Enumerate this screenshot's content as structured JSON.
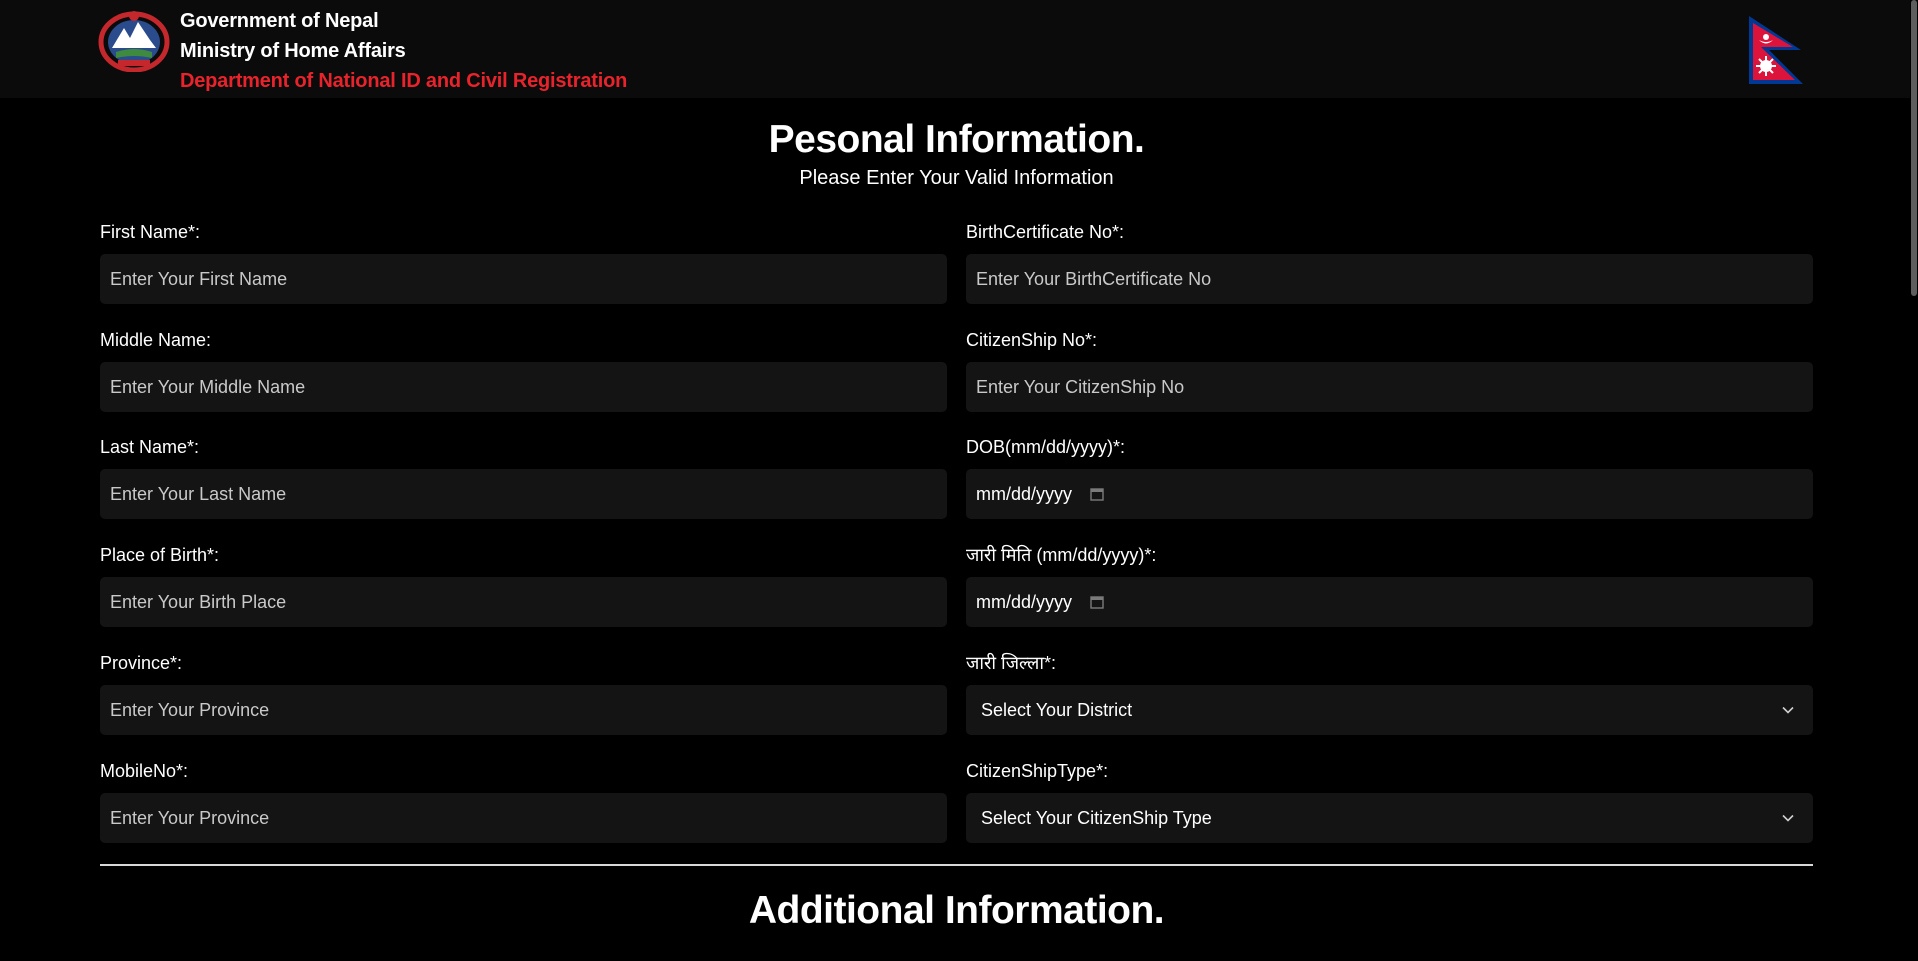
{
  "header": {
    "line1": "Government of Nepal",
    "line2": "Ministry of Home Affairs",
    "line3": "Department of National ID and Civil Registration",
    "accent_color": "#e8232c",
    "emblem_icon": "nepal-emblem-icon",
    "flag_icon": "nepal-flag-icon"
  },
  "personal": {
    "title": "Pesonal Information.",
    "subtitle": "Please Enter Your Valid Information"
  },
  "left_fields": [
    {
      "label": "First Name*:",
      "placeholder": "Enter Your First Name"
    },
    {
      "label": "Middle Name:",
      "placeholder": "Enter Your Middle Name"
    },
    {
      "label": "Last Name*:",
      "placeholder": "Enter Your Last Name"
    },
    {
      "label": "Place of Birth*:",
      "placeholder": "Enter Your Birth Place"
    },
    {
      "label": "Province*:",
      "placeholder": "Enter Your Province"
    },
    {
      "label": "MobileNo*:",
      "placeholder": "Enter Your Province"
    }
  ],
  "right_fields": {
    "birth_cert": {
      "label": "BirthCertificate No*:",
      "placeholder": "Enter Your BirthCertificate No"
    },
    "citizenship_no": {
      "label": "CitizenShip No*:",
      "placeholder": "Enter Your CitizenShip No"
    },
    "dob": {
      "label": "DOB(mm/dd/yyyy)*:",
      "value": "mm/dd/yyyy"
    },
    "issue_date": {
      "label": "जारी मिति (mm/dd/yyyy)*:",
      "value": "mm/dd/yyyy"
    },
    "issue_district": {
      "label": "जारी जिल्ला*:",
      "value": "Select Your District"
    },
    "citizenship_type": {
      "label": "CitizenShipType*:",
      "value": "Select Your CitizenShip Type"
    }
  },
  "additional": {
    "title": "Additional Information."
  }
}
